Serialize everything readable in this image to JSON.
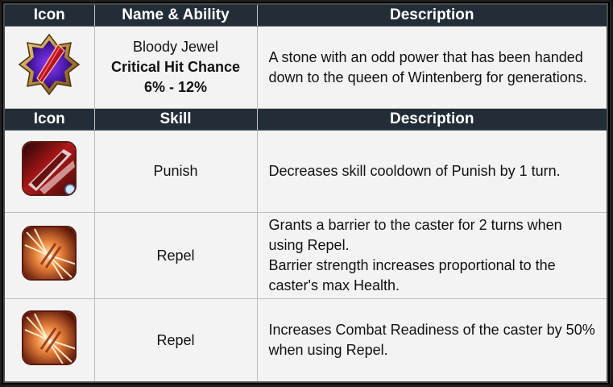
{
  "artifact_header": {
    "icon": "Icon",
    "name_ability": "Name & Ability",
    "description": "Description"
  },
  "artifact": {
    "icon": "bloody-jewel-icon",
    "name": "Bloody Jewel",
    "ability": "Critical Hit Chance",
    "range": "6% - 12%",
    "description": "A stone with an odd power that has been handed down to the queen of Wintenberg for generations."
  },
  "skill_header": {
    "icon": "Icon",
    "skill": "Skill",
    "description": "Description"
  },
  "skills": [
    {
      "icon": "punish-skill-icon",
      "name": "Punish",
      "description_lines": [
        "Decreases skill cooldown of Punish by 1 turn."
      ]
    },
    {
      "icon": "repel-skill-icon",
      "name": "Repel",
      "description_lines": [
        "Grants a barrier to the caster for 2 turns when using Repel.",
        "Barrier strength increases proportional to the caster's max Health."
      ]
    },
    {
      "icon": "repel-skill-icon",
      "name": "Repel",
      "description_lines": [
        "Increases Combat Readiness of the caster by 50% when using Repel."
      ]
    }
  ],
  "colors": {
    "header_bg": "#232d38",
    "cell_bg": "#f3f3f3",
    "frame_bg": "#0e0e0e"
  }
}
